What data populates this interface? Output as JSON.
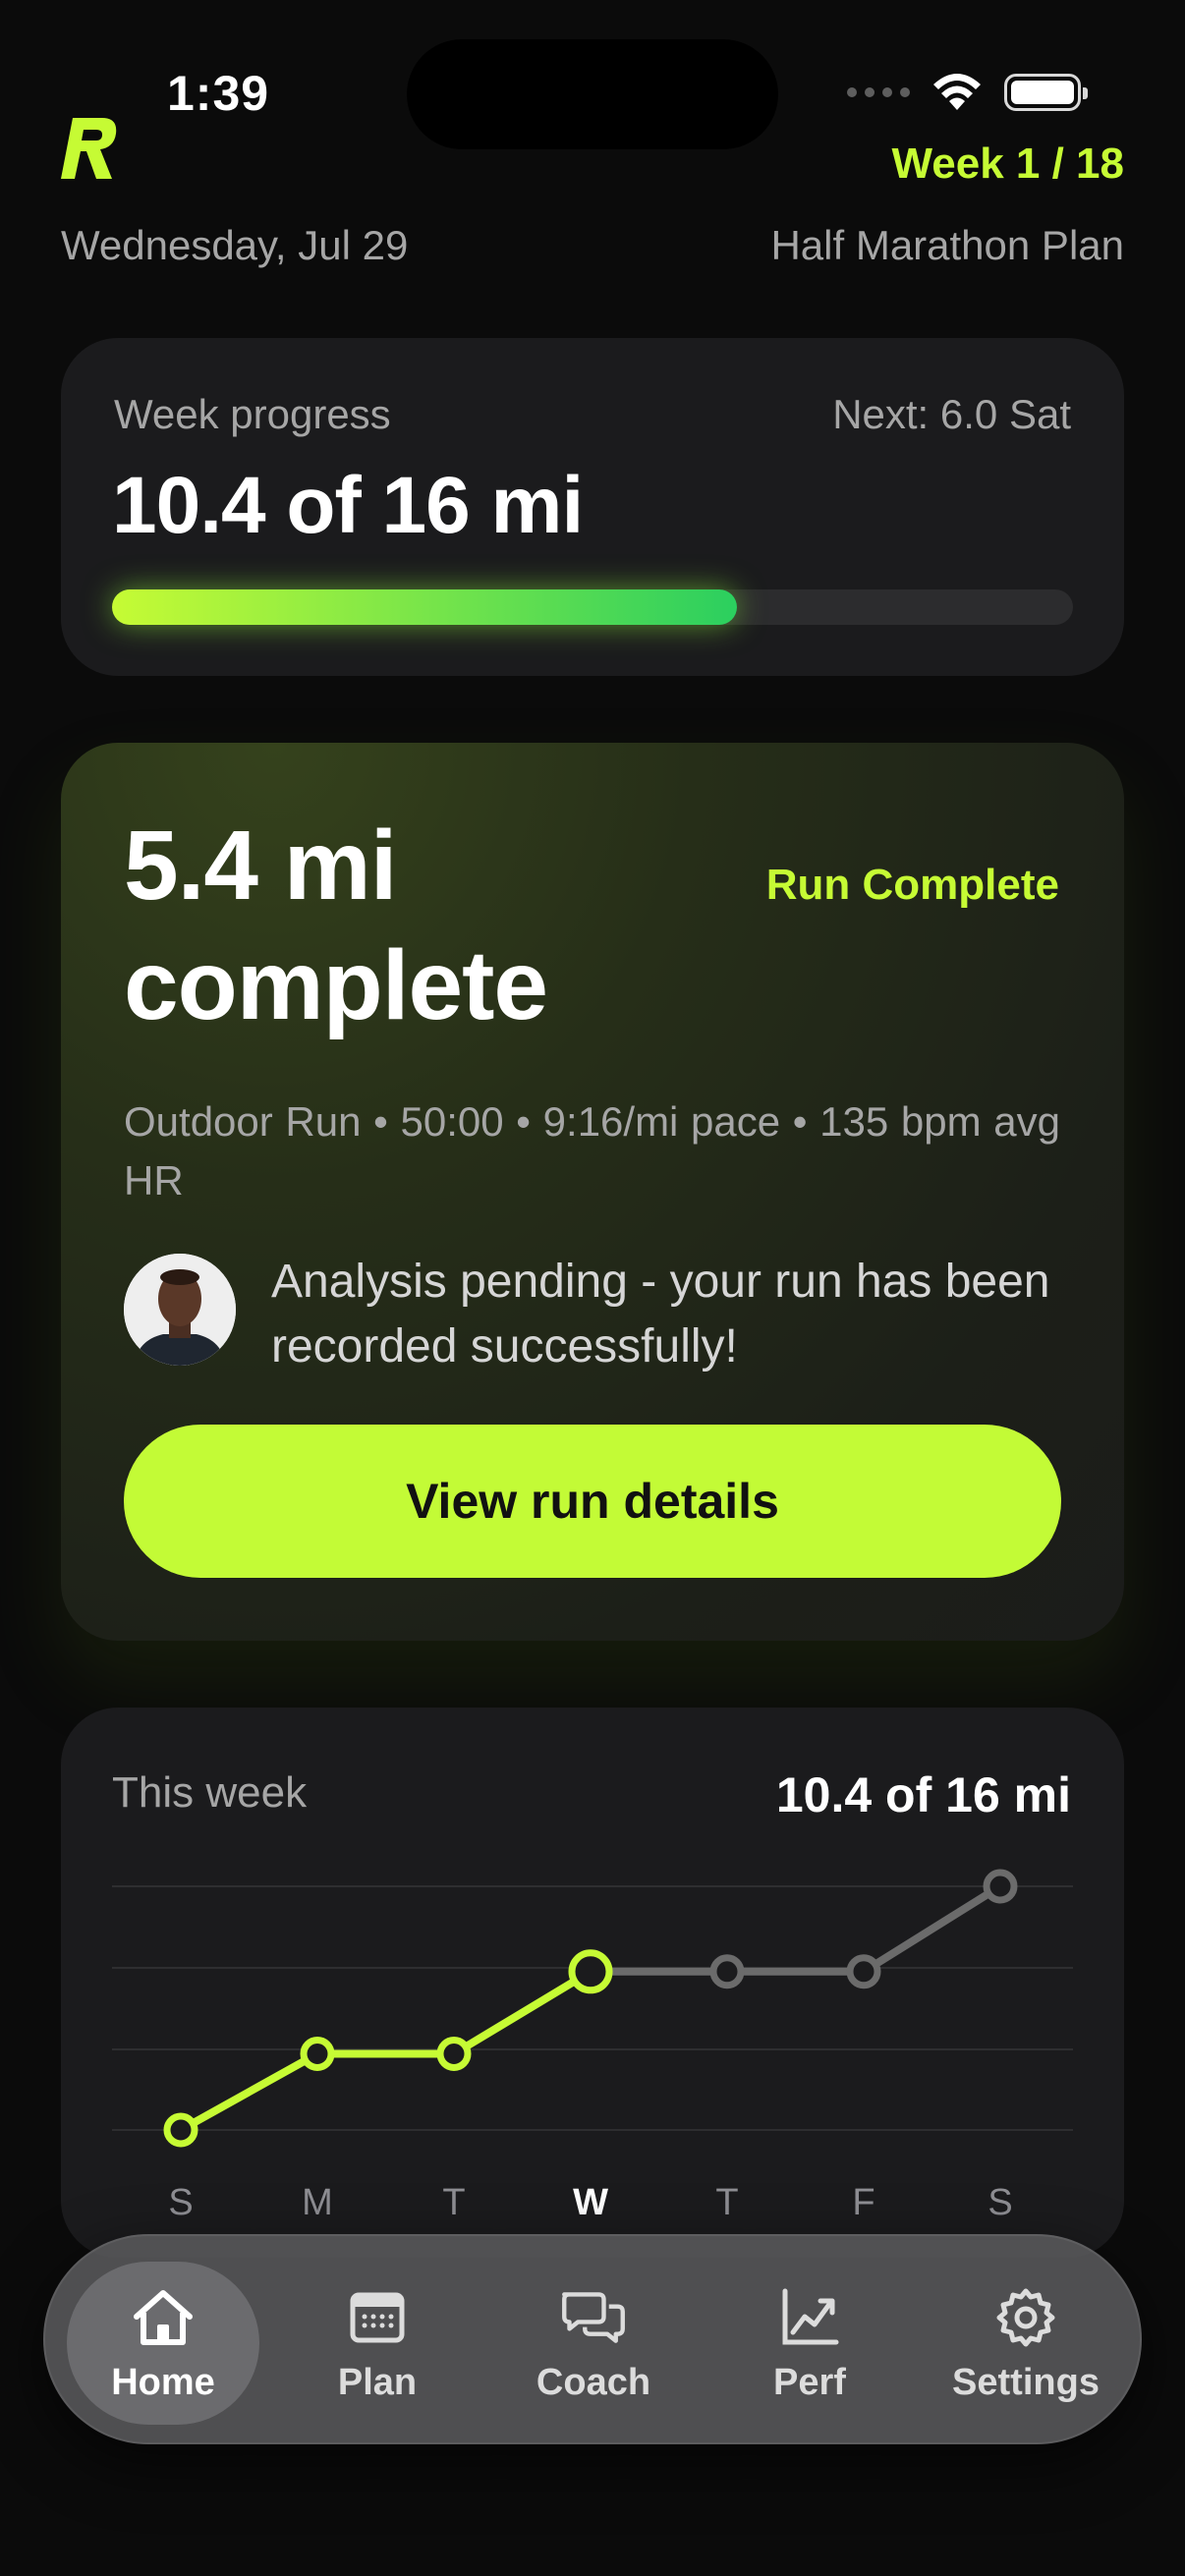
{
  "status_bar": {
    "time": "1:39"
  },
  "header": {
    "week_indicator": "Week 1 / 18",
    "date": "Wednesday, Jul 29",
    "plan_name": "Half Marathon Plan",
    "accent_color": "#c6fb34"
  },
  "week_progress": {
    "label": "Week progress",
    "next": "Next: 6.0 Sat",
    "summary": "10.4 of 16 mi",
    "completed_mi": 10.4,
    "goal_mi": 16,
    "progress_fraction": 0.65
  },
  "run_card": {
    "title_line1": "5.4 mi",
    "title_line2": "complete",
    "badge": "Run Complete",
    "stats": "Outdoor Run  •  50:00  •  9:16/mi pace  •  135 bpm avg HR",
    "coach_message": "Analysis pending - your run has been recorded successfully!",
    "button_label": "View run details"
  },
  "this_week": {
    "label": "This week",
    "total": "10.4 of 16 mi",
    "days": [
      "S",
      "M",
      "T",
      "W",
      "T",
      "F",
      "S"
    ],
    "current_day_index": 3
  },
  "chart_data": {
    "type": "line",
    "categories": [
      "S",
      "M",
      "T",
      "W",
      "T",
      "F",
      "S"
    ],
    "series": [
      {
        "values": [
          0,
          5.0,
          5.0,
          10.4,
          10.4,
          10.4,
          16
        ]
      }
    ],
    "completed_through_index": 3,
    "ylim": [
      0,
      16
    ],
    "colors": {
      "completed": "#c6fb34",
      "planned": "#6b6b6b"
    },
    "grid": true
  },
  "tab_bar": {
    "tabs": [
      {
        "label": "Home",
        "icon": "home-icon",
        "active": true
      },
      {
        "label": "Plan",
        "icon": "calendar-icon",
        "active": false
      },
      {
        "label": "Coach",
        "icon": "chat-bubbles-icon",
        "active": false
      },
      {
        "label": "Perf",
        "icon": "trend-chart-icon",
        "active": false
      },
      {
        "label": "Settings",
        "icon": "gear-icon",
        "active": false
      }
    ]
  }
}
